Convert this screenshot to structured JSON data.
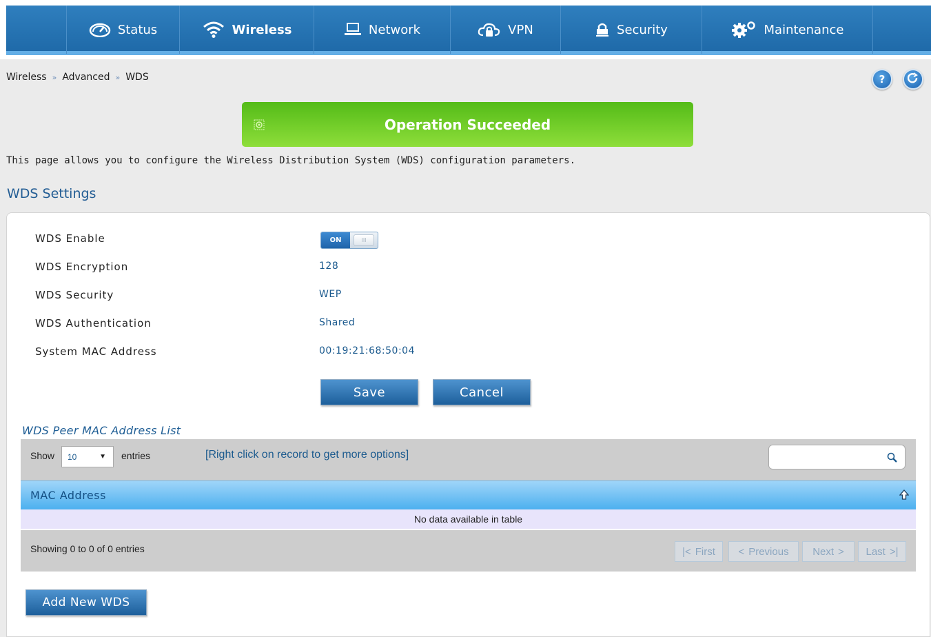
{
  "nav": {
    "items": [
      {
        "label": "Status",
        "icon": "speedometer-icon"
      },
      {
        "label": "Wireless",
        "icon": "wifi-icon",
        "active": true
      },
      {
        "label": "Network",
        "icon": "monitor-icon"
      },
      {
        "label": "VPN",
        "icon": "cloud-lock-icon"
      },
      {
        "label": "Security",
        "icon": "lock-icon"
      },
      {
        "label": "Maintenance",
        "icon": "gears-icon"
      }
    ]
  },
  "breadcrumb": {
    "items": [
      "Wireless",
      "Advanced",
      "WDS"
    ],
    "separator": "»"
  },
  "header_buttons": {
    "help": "?",
    "logout": "logout-icon"
  },
  "banner": {
    "text": "Operation Succeeded",
    "color": "#6fcc28"
  },
  "description": "This page allows you to configure the Wireless Distribution System (WDS) configuration parameters.",
  "section_title": "WDS Settings",
  "settings": {
    "enable": {
      "label": "WDS Enable",
      "on_text": "ON",
      "off_text": "III"
    },
    "encryption": {
      "label": "WDS Encryption",
      "value": "128"
    },
    "security": {
      "label": "WDS Security",
      "value": "WEP"
    },
    "authentication": {
      "label": "WDS Authentication",
      "value": "Shared"
    },
    "mac": {
      "label": "System MAC Address",
      "value": "00:19:21:68:50:04"
    }
  },
  "actions": {
    "save": "Save",
    "cancel": "Cancel"
  },
  "peer_list": {
    "title": "WDS Peer MAC Address List",
    "show_label": "Show",
    "page_size": "10",
    "entries_label": "entries",
    "hint": "[Right click on record to get more options]",
    "search_placeholder": "",
    "columns": [
      "MAC Address"
    ],
    "empty_text": "No data available in table",
    "info": "Showing 0 to 0 of 0 entries",
    "pager": {
      "first": "First",
      "previous": "Previous",
      "next": "Next",
      "last": "Last"
    }
  },
  "add_button": "Add New WDS",
  "colors": {
    "nav": "#2374b5",
    "accent": "#63aee6",
    "button": "#2f7bc0",
    "success": "#6fcc28"
  }
}
